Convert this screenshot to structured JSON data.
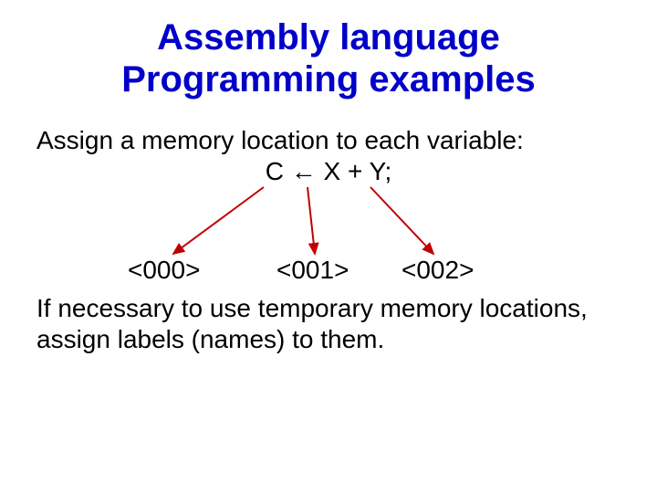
{
  "title_line1": "Assembly  language",
  "title_line2": "Programming examples",
  "body": {
    "assign_line": "Assign a memory location to each variable:",
    "expression": "C ← X + Y;",
    "addr0": "<000>",
    "addr1": "<001>",
    "addr2": "<002>",
    "note_line1": "If necessary to use temporary memory locations,",
    "note_line2": "assign labels (names) to them."
  },
  "colors": {
    "title": "#0000c8",
    "arrow": "#c00000",
    "text": "#000000"
  }
}
